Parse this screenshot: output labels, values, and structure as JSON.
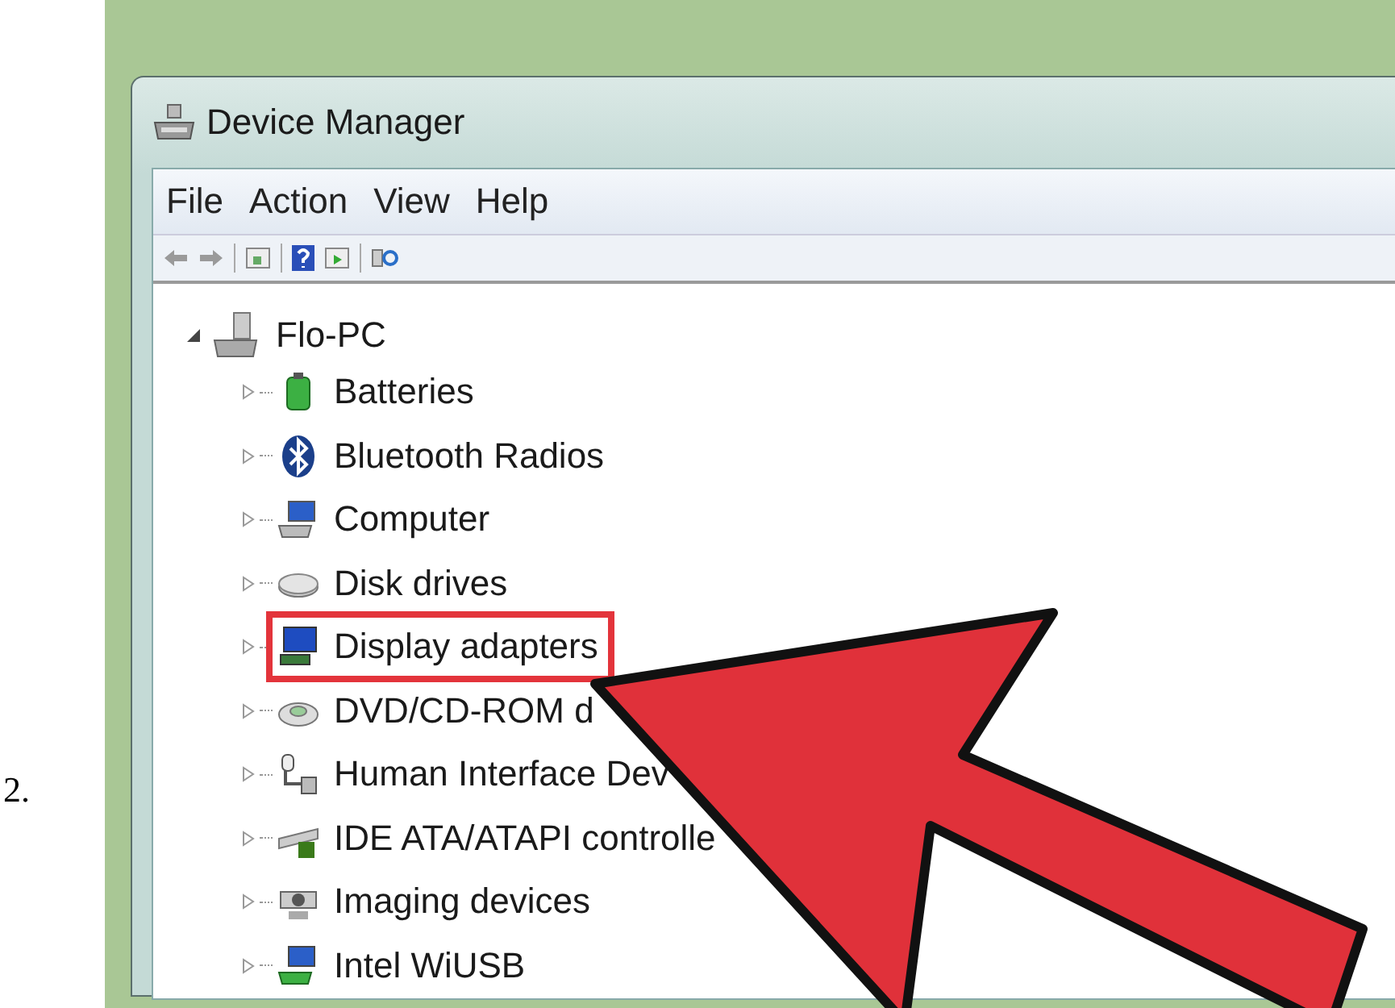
{
  "step_number": "2.",
  "window": {
    "title": "Device Manager"
  },
  "menu": [
    "File",
    "Action",
    "View",
    "Help"
  ],
  "tree": {
    "label": "Flo-PC",
    "expanded": true,
    "children": [
      {
        "label": "Batteries",
        "expanded": false,
        "highlighted": false
      },
      {
        "label": "Bluetooth Radios",
        "expanded": false,
        "highlighted": false
      },
      {
        "label": "Computer",
        "expanded": false,
        "highlighted": false
      },
      {
        "label": "Disk drives",
        "expanded": false,
        "highlighted": false
      },
      {
        "label": "Display adapters",
        "expanded": false,
        "highlighted": true
      },
      {
        "label": "DVD/CD-ROM d",
        "expanded": false,
        "highlighted": false
      },
      {
        "label": "Human Interface Dev",
        "expanded": false,
        "highlighted": false
      },
      {
        "label": "IDE ATA/ATAPI controlle",
        "expanded": false,
        "highlighted": false
      },
      {
        "label": "Imaging devices",
        "expanded": false,
        "highlighted": false
      },
      {
        "label": "Intel WiUSB",
        "expanded": false,
        "highlighted": false
      }
    ]
  }
}
